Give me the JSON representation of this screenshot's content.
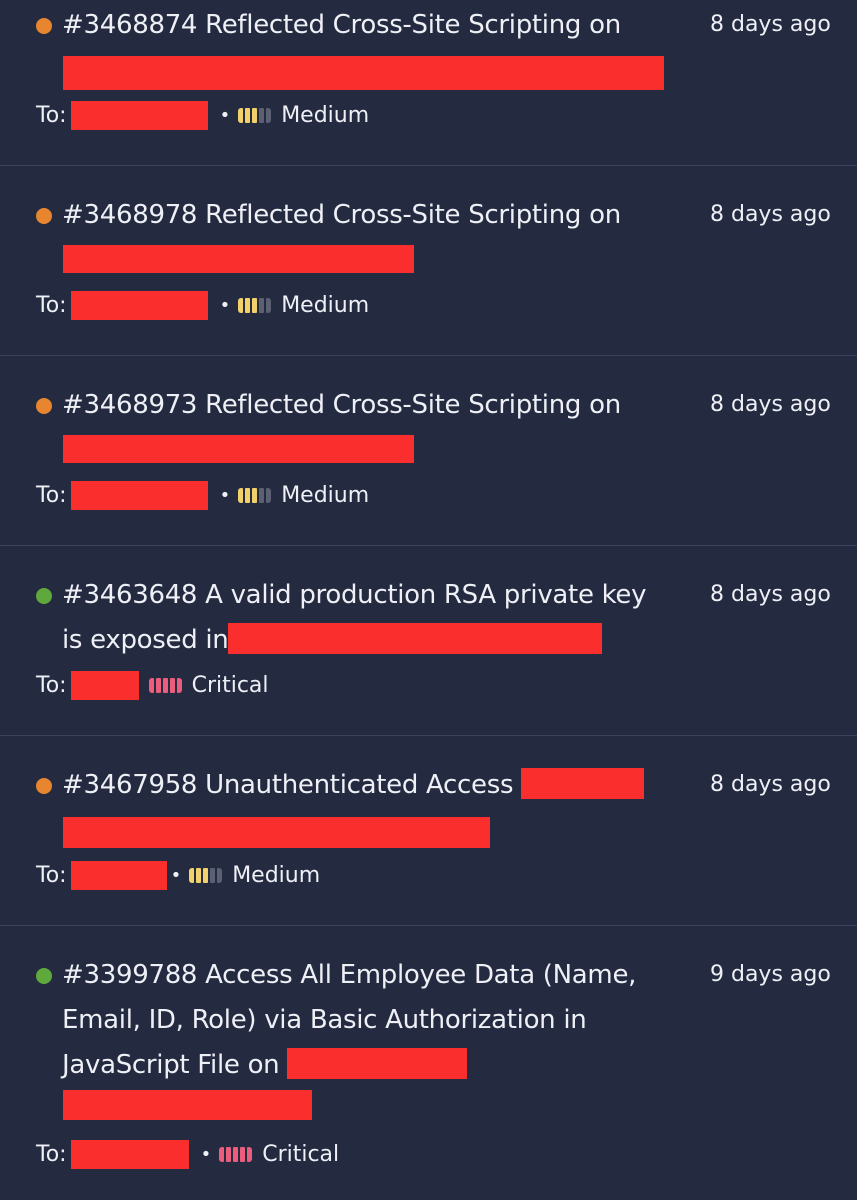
{
  "reports": [
    {
      "id": "#3468874",
      "title_lines": [
        "#3468874 Reflected Cross-Site Scripting on"
      ],
      "time": "8 days ago",
      "to_label": "To:",
      "severity": "Medium",
      "severity_level": 3,
      "status_color": "#e8862f"
    },
    {
      "id": "#3468978",
      "title_lines": [
        "#3468978 Reflected Cross-Site Scripting on"
      ],
      "time": "8 days ago",
      "to_label": "To:",
      "severity": "Medium",
      "severity_level": 3,
      "status_color": "#e8862f"
    },
    {
      "id": "#3468973",
      "title_lines": [
        "#3468973 Reflected Cross-Site Scripting on"
      ],
      "time": "8 days ago",
      "to_label": "To:",
      "severity": "Medium",
      "severity_level": 3,
      "status_color": "#e8862f"
    },
    {
      "id": "#3463648",
      "title_lines": [
        "#3463648 A valid production RSA private key",
        "is exposed in"
      ],
      "time": "8 days ago",
      "to_label": "To:",
      "severity": "Critical",
      "severity_level": 5,
      "status_color": "#5fa83b"
    },
    {
      "id": "#3467958",
      "title_lines": [
        "#3467958 Unauthenticated Access"
      ],
      "time": "8 days ago",
      "to_label": "To:",
      "severity": "Medium",
      "severity_level": 3,
      "status_color": "#e8862f"
    },
    {
      "id": "#3399788",
      "title_lines": [
        "#3399788 Access All Employee Data (Name,",
        "Email, ID, Role) via Basic Authorization in",
        "JavaScript File on"
      ],
      "time": "9 days ago",
      "to_label": "To:",
      "severity": "Critical",
      "severity_level": 5,
      "status_color": "#5fa83b"
    }
  ],
  "colors": {
    "background": "#242a40",
    "redaction": "#fb2e2e",
    "medium": "#f2d16b",
    "critical": "#ea5d7d",
    "divider": "#3b4259"
  }
}
